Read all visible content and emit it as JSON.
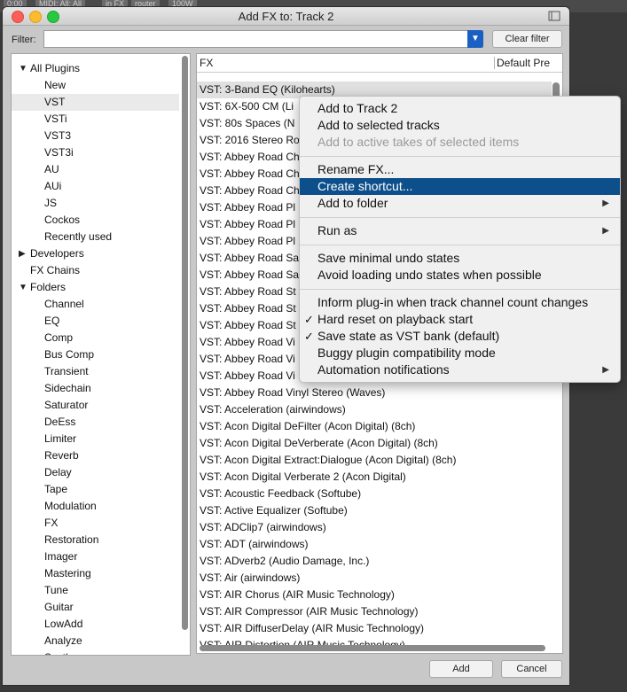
{
  "background": {
    "tabs": [
      "0:00",
      "MIDI: All: All",
      "in FX",
      "router",
      "100W"
    ]
  },
  "window": {
    "title": "Add FX to: Track 2",
    "filter_label": "Filter:",
    "filter_value": "",
    "clear_filter_label": "Clear filter",
    "add_label": "Add",
    "cancel_label": "Cancel"
  },
  "tree": {
    "items": [
      {
        "label": "All Plugins",
        "level": 0,
        "arrow": "open"
      },
      {
        "label": "New",
        "level": 2
      },
      {
        "label": "VST",
        "level": 2,
        "selected": true
      },
      {
        "label": "VSTi",
        "level": 2
      },
      {
        "label": "VST3",
        "level": 2
      },
      {
        "label": "VST3i",
        "level": 2
      },
      {
        "label": "AU",
        "level": 2
      },
      {
        "label": "AUi",
        "level": 2
      },
      {
        "label": "JS",
        "level": 2
      },
      {
        "label": "Cockos",
        "level": 2
      },
      {
        "label": "Recently used",
        "level": 2
      },
      {
        "label": "Developers",
        "level": 0,
        "arrow": "closed"
      },
      {
        "label": "FX Chains",
        "level": 1
      },
      {
        "label": "Folders",
        "level": 0,
        "arrow": "open"
      },
      {
        "label": "Channel",
        "level": 2
      },
      {
        "label": "EQ",
        "level": 2
      },
      {
        "label": "Comp",
        "level": 2
      },
      {
        "label": "Bus Comp",
        "level": 2
      },
      {
        "label": "Transient",
        "level": 2
      },
      {
        "label": "Sidechain",
        "level": 2
      },
      {
        "label": "Saturator",
        "level": 2
      },
      {
        "label": "DeEss",
        "level": 2
      },
      {
        "label": "Limiter",
        "level": 2
      },
      {
        "label": "Reverb",
        "level": 2
      },
      {
        "label": "Delay",
        "level": 2
      },
      {
        "label": "Tape",
        "level": 2
      },
      {
        "label": "Modulation",
        "level": 2
      },
      {
        "label": "FX",
        "level": 2
      },
      {
        "label": "Restoration",
        "level": 2
      },
      {
        "label": "Imager",
        "level": 2
      },
      {
        "label": "Mastering",
        "level": 2
      },
      {
        "label": "Tune",
        "level": 2
      },
      {
        "label": "Guitar",
        "level": 2
      },
      {
        "label": "LowAdd",
        "level": 2
      },
      {
        "label": "Analyze",
        "level": 2
      },
      {
        "label": "Synth",
        "level": 2
      }
    ]
  },
  "fx_list": {
    "col_fx": "FX",
    "col_default": "Default Pre",
    "rows": [
      {
        "label": "VST: 3-Band EQ (Kilohearts)",
        "selected": true
      },
      {
        "label": "VST: 6X-500 CM (Li"
      },
      {
        "label": "VST: 80s Spaces (N"
      },
      {
        "label": "VST: 2016 Stereo Ro"
      },
      {
        "label": "VST: Abbey Road Ch"
      },
      {
        "label": "VST: Abbey Road Ch"
      },
      {
        "label": "VST: Abbey Road Ch"
      },
      {
        "label": "VST: Abbey Road Pl"
      },
      {
        "label": "VST: Abbey Road Pl"
      },
      {
        "label": "VST: Abbey Road Pl"
      },
      {
        "label": "VST: Abbey Road Sa"
      },
      {
        "label": "VST: Abbey Road Sa"
      },
      {
        "label": "VST: Abbey Road St"
      },
      {
        "label": "VST: Abbey Road St"
      },
      {
        "label": "VST: Abbey Road St"
      },
      {
        "label": "VST: Abbey Road Vi"
      },
      {
        "label": "VST: Abbey Road Vi"
      },
      {
        "label": "VST: Abbey Road Vi"
      },
      {
        "label": "VST: Abbey Road Vinyl Stereo (Waves)"
      },
      {
        "label": "VST: Acceleration (airwindows)"
      },
      {
        "label": "VST: Acon Digital DeFilter (Acon Digital) (8ch)"
      },
      {
        "label": "VST: Acon Digital DeVerberate (Acon Digital) (8ch)"
      },
      {
        "label": "VST: Acon Digital Extract:Dialogue (Acon Digital) (8ch)"
      },
      {
        "label": "VST: Acon Digital Verberate 2 (Acon Digital)"
      },
      {
        "label": "VST: Acoustic Feedback (Softube)"
      },
      {
        "label": "VST: Active Equalizer (Softube)"
      },
      {
        "label": "VST: ADClip7 (airwindows)"
      },
      {
        "label": "VST: ADT (airwindows)"
      },
      {
        "label": "VST: ADverb2 (Audio Damage, Inc.)"
      },
      {
        "label": "VST: Air (airwindows)"
      },
      {
        "label": "VST: AIR Chorus (AIR Music Technology)"
      },
      {
        "label": "VST: AIR Compressor (AIR Music Technology)"
      },
      {
        "label": "VST: AIR DiffuserDelay (AIR Music Technology)"
      },
      {
        "label": "VST: AIR Distortion (AIR Music Technology)"
      }
    ]
  },
  "context_menu": {
    "items": [
      {
        "type": "item",
        "label": "Add to Track 2"
      },
      {
        "type": "item",
        "label": "Add to selected tracks"
      },
      {
        "type": "item",
        "label": "Add to active takes of selected items",
        "disabled": true
      },
      {
        "type": "sep"
      },
      {
        "type": "item",
        "label": "Rename FX..."
      },
      {
        "type": "item",
        "label": "Create shortcut...",
        "highlighted": true
      },
      {
        "type": "item",
        "label": "Add to folder",
        "submenu": true
      },
      {
        "type": "sep"
      },
      {
        "type": "item",
        "label": "Run as",
        "submenu": true
      },
      {
        "type": "sep"
      },
      {
        "type": "item",
        "label": "Save minimal undo states"
      },
      {
        "type": "item",
        "label": "Avoid loading undo states when possible"
      },
      {
        "type": "sep"
      },
      {
        "type": "item",
        "label": "Inform plug-in when track channel count changes"
      },
      {
        "type": "item",
        "label": "Hard reset on playback start",
        "checked": true
      },
      {
        "type": "item",
        "label": "Save state as VST bank (default)",
        "checked": true
      },
      {
        "type": "item",
        "label": "Buggy plugin compatibility mode"
      },
      {
        "type": "item",
        "label": "Automation notifications",
        "submenu": true
      }
    ],
    "check_glyph": "✓",
    "submenu_glyph": "▶"
  },
  "colors": {
    "menu_highlight": "#0d4f8b",
    "filter_dropdown": "#1a5fc2"
  }
}
